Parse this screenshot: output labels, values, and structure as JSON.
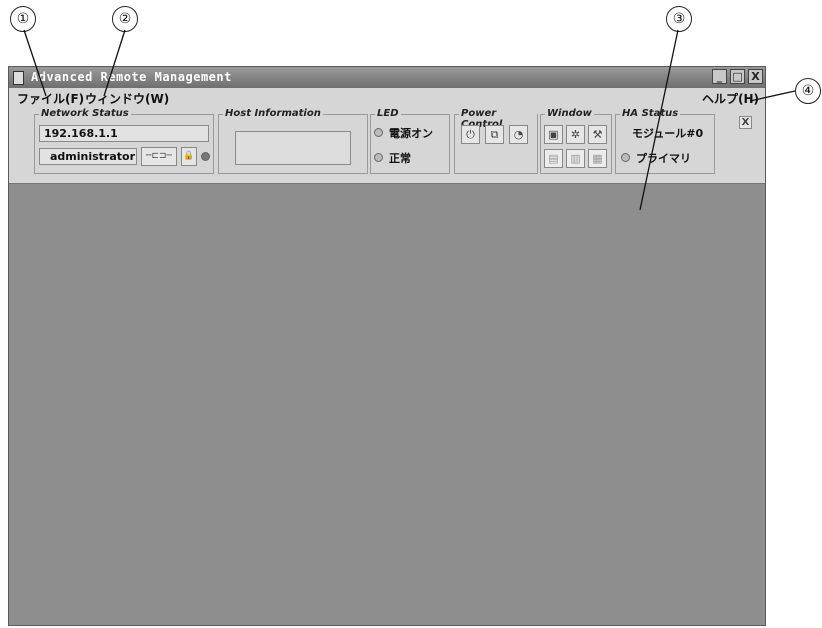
{
  "callouts": [
    "①",
    "②",
    "③",
    "④"
  ],
  "window": {
    "title": "Advanced Remote Management",
    "controls": {
      "minimize": "_",
      "maximize": "□",
      "close": "X"
    }
  },
  "menu": {
    "file": "ファイル(F)",
    "window": "ウィンドウ(W)",
    "help": "ヘルプ(H)"
  },
  "panel": {
    "close_glyph": "X",
    "network_status": {
      "label": "Network Status",
      "ip": "192.168.1.1",
      "user": "administrator",
      "connect_glyph": "─⊏⊐─",
      "lock_glyph": "🔒"
    },
    "host_information": {
      "label": "Host Information",
      "value": ""
    },
    "led": {
      "label": "LED",
      "power": "電源オン",
      "status": "正常"
    },
    "power_control": {
      "label": "Power Control",
      "icons": [
        "power-button-icon",
        "reset-icon",
        "power-cycle-icon"
      ],
      "glyphs": [
        "⏻",
        "⧉",
        "◔"
      ]
    },
    "window_group": {
      "label": "Window",
      "icons": [
        "console-icon",
        "settings-icon",
        "tool-icon",
        "log-icon",
        "info-icon",
        "sensor-icon"
      ],
      "glyphs": [
        "▣",
        "✲",
        "⚒",
        "▤",
        "▥",
        "▦"
      ]
    },
    "ha_status": {
      "label": "HA Status",
      "module": "モジュール#0",
      "role": "プライマリ"
    }
  }
}
